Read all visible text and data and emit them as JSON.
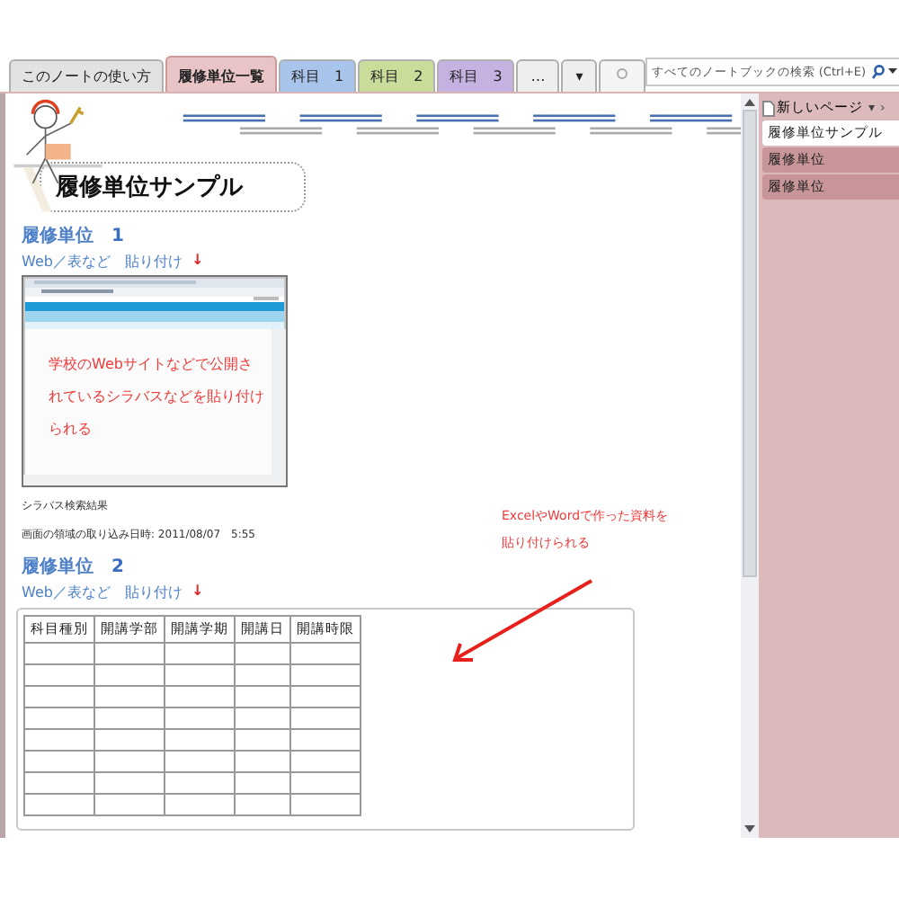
{
  "tabs": [
    {
      "label": "このノートの使い方",
      "selected": false,
      "color": "#e2e2e2"
    },
    {
      "label": "履修単位一覧",
      "selected": true,
      "color": "#e8c4c6"
    },
    {
      "label": "科目　1",
      "selected": false,
      "color": "#a9c4ea"
    },
    {
      "label": "科目　2",
      "selected": false,
      "color": "#c9dc9a"
    },
    {
      "label": "科目　3",
      "selected": false,
      "color": "#c6b2e0"
    }
  ],
  "more_tabs": "…",
  "tab_menu": "▾",
  "search": {
    "placeholder": "すべてのノートブックの検索 (Ctrl+E)"
  },
  "page": {
    "title": "履修単位サンプル",
    "sections": [
      {
        "heading": "履修単位　**1**",
        "subheading": "Web／表など　貼り付け",
        "mark": "↓",
        "kind": "screenshot",
        "overlay_text": "学校のWebサイトなどで公開されているシラバスなどを貼り付けられる",
        "caption": "シラバス検索結果",
        "timestamp": "画面の領域の取り込み日時:  2011/08/07　5:55"
      },
      {
        "heading": "履修単位　**2**",
        "subheading": "Web／表など　貼り付け",
        "mark": "↓",
        "kind": "table",
        "columns": [
          "科目種別",
          "開講学部",
          "開講学期",
          "開講日",
          "開講時限"
        ]
      }
    ],
    "note": "ExcelやWordで作った資料を貼り付けられる"
  },
  "side_panel": {
    "new_page": "新しいページ",
    "menu": "▾",
    "collapse": "›",
    "pages": [
      {
        "label": "履修単位サンプル",
        "selected": true
      },
      {
        "label": "履修単位",
        "selected": false
      },
      {
        "label": "履修単位",
        "selected": false
      }
    ]
  }
}
